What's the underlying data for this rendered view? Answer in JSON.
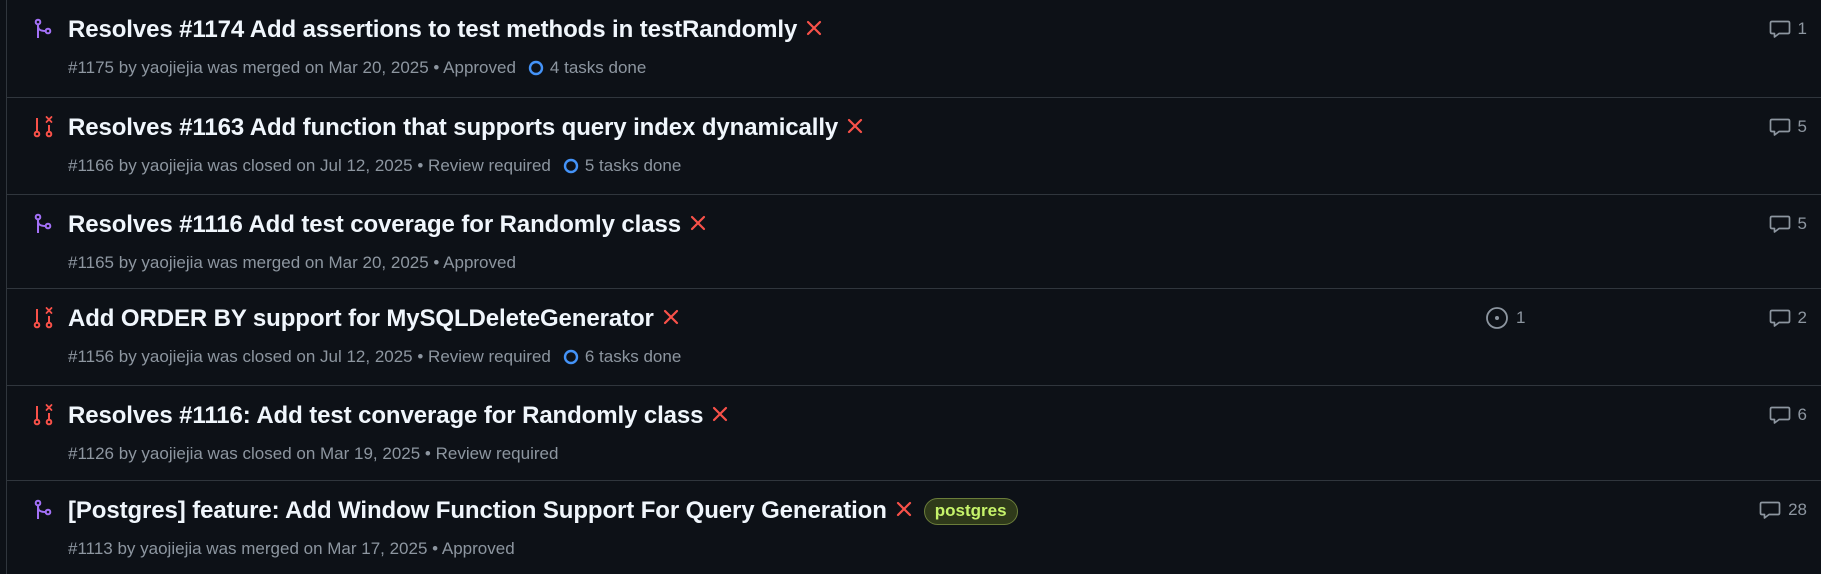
{
  "colors": {
    "merged": "#a371f7",
    "closed": "#f85149",
    "x_mark": "#f85149",
    "task_ring": "#4493f8",
    "label_text": "#c6f36a"
  },
  "pull_requests": [
    {
      "state": "merged",
      "state_icon": "git-merge-icon",
      "title": "Resolves #1174 Add assertions to test methods in testRandomly",
      "meta": "#1175 by yaojiejia was merged on Mar 20, 2025 • Approved",
      "tasks": "4 tasks done",
      "comments": "1"
    },
    {
      "state": "closed",
      "state_icon": "git-pull-request-closed-icon",
      "title": "Resolves #1163 Add function that supports query index dynamically",
      "meta": "#1166 by yaojiejia was closed on Jul 12, 2025 • Review required",
      "tasks": "5 tasks done",
      "comments": "5"
    },
    {
      "state": "merged",
      "state_icon": "git-merge-icon",
      "title": "Resolves #1116 Add test coverage for Randomly class",
      "meta": "#1165 by yaojiejia was merged on Mar 20, 2025 • Approved",
      "comments": "5"
    },
    {
      "state": "closed",
      "state_icon": "git-pull-request-closed-icon",
      "title": "Add ORDER BY support for MySQLDeleteGenerator",
      "meta": "#1156 by yaojiejia was closed on Jul 12, 2025 • Review required",
      "tasks": "6 tasks done",
      "linked_issues": "1",
      "comments": "2"
    },
    {
      "state": "closed",
      "state_icon": "git-pull-request-closed-icon",
      "title": "Resolves #1116: Add test converage for Randomly class",
      "meta": "#1126 by yaojiejia was closed on Mar 19, 2025 • Review required",
      "comments": "6"
    },
    {
      "state": "merged",
      "state_icon": "git-merge-icon",
      "title": "[Postgres] feature: Add Window Function Support For Query Generation",
      "meta": "#1113 by yaojiejia was merged on Mar 17, 2025 • Approved",
      "label": "postgres",
      "comments": "28"
    }
  ]
}
